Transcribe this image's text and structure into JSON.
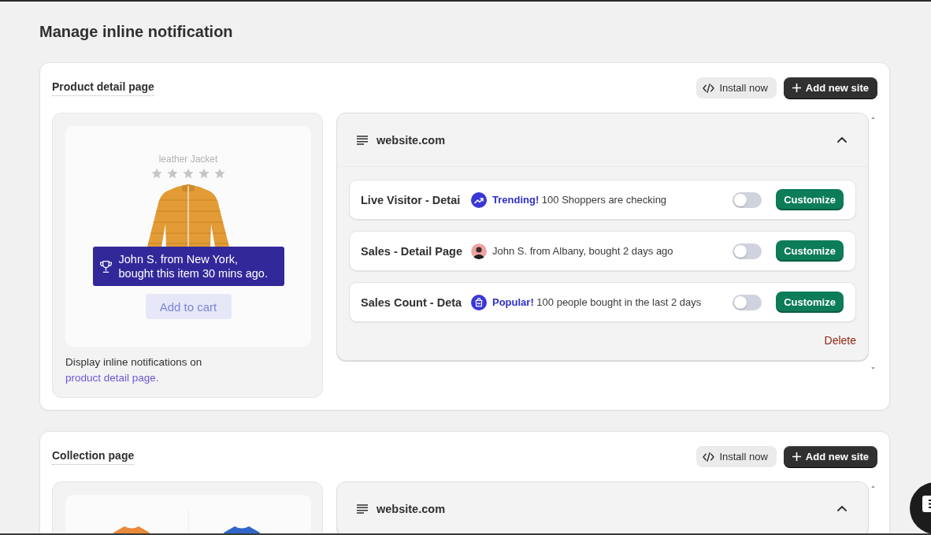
{
  "page": {
    "title": "Manage inline notification"
  },
  "sections": [
    {
      "title": "Product detail page",
      "install_label": "Install now",
      "add_label": "Add new site",
      "preview": {
        "kind": "product",
        "product_name": "leather Jacket",
        "stars": 0,
        "notification": "John S. from New York,\nbought this item 30 mins ago.",
        "cart_label": "Add to cart",
        "caption": "Display inline notifications on",
        "caption_link": "product detail page."
      },
      "site": {
        "name": "website.com",
        "expanded": true,
        "notifications": [
          {
            "title": "Live Visitor - Detai",
            "kind": "trending",
            "message": "**Trending!** 100 Shoppers are checking",
            "on": false,
            "action": "Customize"
          },
          {
            "title": "Sales - Detail Page",
            "kind": "avatar",
            "message": "John S. from Albany, bought 2 days ago",
            "on": false,
            "action": "Customize"
          },
          {
            "title": "Sales Count - Deta",
            "kind": "bag",
            "message": "**Popular!** 100 people bought in the last 2 days",
            "on": false,
            "action": "Customize"
          }
        ],
        "delete_label": "Delete"
      }
    },
    {
      "title": "Collection page",
      "install_label": "Install now",
      "add_label": "Add new site",
      "preview": {
        "kind": "collection"
      },
      "site": {
        "name": "website.com",
        "expanded": true
      }
    }
  ]
}
